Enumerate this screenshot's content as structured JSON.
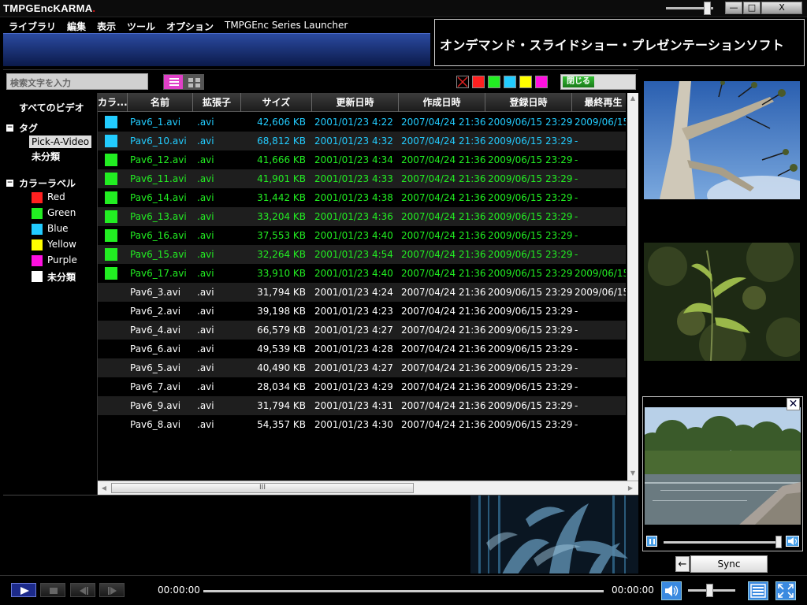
{
  "app": {
    "title_prefix": "TMPGEnc",
    "title_main": "KARMA",
    "title_dot": ".",
    "window_buttons": {
      "minimize": "—",
      "maximize": "□",
      "close": "X"
    }
  },
  "menu": [
    "ライブラリ",
    "編集",
    "表示",
    "ツール",
    "オプション",
    "TMPGEnc Series Launcher"
  ],
  "banner": "オンデマンド・スライドショー・プレゼンテーションソフト",
  "toolbar": {
    "search_placeholder": "検索文字を入力",
    "filter_colors": [
      "#ff2020",
      "#22ee22",
      "#22ccff",
      "#ffff00",
      "#ff10e0"
    ],
    "close_label": "閉じる"
  },
  "tree": {
    "all_videos": "すべてのビデオ",
    "tag_header": "タグ",
    "tag_expander": "−",
    "tags": [
      "Pick-A-Video",
      "未分類"
    ],
    "color_header": "カラーラベル",
    "color_expander": "−",
    "color_labels": [
      {
        "name": "Red",
        "color": "#ff2020"
      },
      {
        "name": "Green",
        "color": "#22ee22"
      },
      {
        "name": "Blue",
        "color": "#22ccff"
      },
      {
        "name": "Yellow",
        "color": "#ffff00"
      },
      {
        "name": "Purple",
        "color": "#ff10e0"
      },
      {
        "name": "未分類",
        "color": "#ffffff"
      }
    ]
  },
  "table": {
    "columns": [
      "カラ...",
      "名前",
      "拡張子",
      "サイズ",
      "更新日時",
      "作成日時",
      "登録日時",
      "最終再生"
    ],
    "rows": [
      {
        "color": "#22ccff",
        "text_color": "#22ccff",
        "name": "Pav6_1.avi",
        "ext": ".avi",
        "size": "42,606 KB",
        "modified": "2001/01/23 4:22",
        "created": "2007/04/24 21:36",
        "registered": "2009/06/15 23:29",
        "last_played": "2009/06/15"
      },
      {
        "color": "#22ccff",
        "text_color": "#22ccff",
        "name": "Pav6_10.avi",
        "ext": ".avi",
        "size": "68,812 KB",
        "modified": "2001/01/23 4:32",
        "created": "2007/04/24 21:36",
        "registered": "2009/06/15 23:29",
        "last_played": "-"
      },
      {
        "color": "#22ee22",
        "text_color": "#22ee22",
        "name": "Pav6_12.avi",
        "ext": ".avi",
        "size": "41,666 KB",
        "modified": "2001/01/23 4:34",
        "created": "2007/04/24 21:36",
        "registered": "2009/06/15 23:29",
        "last_played": "-"
      },
      {
        "color": "#22ee22",
        "text_color": "#22ee22",
        "name": "Pav6_11.avi",
        "ext": ".avi",
        "size": "41,901 KB",
        "modified": "2001/01/23 4:33",
        "created": "2007/04/24 21:36",
        "registered": "2009/06/15 23:29",
        "last_played": "-"
      },
      {
        "color": "#22ee22",
        "text_color": "#22ee22",
        "name": "Pav6_14.avi",
        "ext": ".avi",
        "size": "31,442 KB",
        "modified": "2001/01/23 4:38",
        "created": "2007/04/24 21:36",
        "registered": "2009/06/15 23:29",
        "last_played": "-"
      },
      {
        "color": "#22ee22",
        "text_color": "#22ee22",
        "name": "Pav6_13.avi",
        "ext": ".avi",
        "size": "33,204 KB",
        "modified": "2001/01/23 4:36",
        "created": "2007/04/24 21:36",
        "registered": "2009/06/15 23:29",
        "last_played": "-"
      },
      {
        "color": "#22ee22",
        "text_color": "#22ee22",
        "name": "Pav6_16.avi",
        "ext": ".avi",
        "size": "37,553 KB",
        "modified": "2001/01/23 4:40",
        "created": "2007/04/24 21:36",
        "registered": "2009/06/15 23:29",
        "last_played": "-"
      },
      {
        "color": "#22ee22",
        "text_color": "#22ee22",
        "name": "Pav6_15.avi",
        "ext": ".avi",
        "size": "32,264 KB",
        "modified": "2001/01/23 4:54",
        "created": "2007/04/24 21:36",
        "registered": "2009/06/15 23:29",
        "last_played": "-"
      },
      {
        "color": "#22ee22",
        "text_color": "#22ee22",
        "name": "Pav6_17.avi",
        "ext": ".avi",
        "size": "33,910 KB",
        "modified": "2001/01/23 4:40",
        "created": "2007/04/24 21:36",
        "registered": "2009/06/15 23:29",
        "last_played": "2009/06/15"
      },
      {
        "color": "",
        "text_color": "#ffffff",
        "name": "Pav6_3.avi",
        "ext": ".avi",
        "size": "31,794 KB",
        "modified": "2001/01/23 4:24",
        "created": "2007/04/24 21:36",
        "registered": "2009/06/15 23:29",
        "last_played": "2009/06/15"
      },
      {
        "color": "",
        "text_color": "#ffffff",
        "name": "Pav6_2.avi",
        "ext": ".avi",
        "size": "39,198 KB",
        "modified": "2001/01/23 4:23",
        "created": "2007/04/24 21:36",
        "registered": "2009/06/15 23:29",
        "last_played": "-"
      },
      {
        "color": "",
        "text_color": "#ffffff",
        "name": "Pav6_4.avi",
        "ext": ".avi",
        "size": "66,579 KB",
        "modified": "2001/01/23 4:27",
        "created": "2007/04/24 21:36",
        "registered": "2009/06/15 23:29",
        "last_played": "-"
      },
      {
        "color": "",
        "text_color": "#ffffff",
        "name": "Pav6_6.avi",
        "ext": ".avi",
        "size": "49,539 KB",
        "modified": "2001/01/23 4:28",
        "created": "2007/04/24 21:36",
        "registered": "2009/06/15 23:29",
        "last_played": "-"
      },
      {
        "color": "",
        "text_color": "#ffffff",
        "name": "Pav6_5.avi",
        "ext": ".avi",
        "size": "40,490 KB",
        "modified": "2001/01/23 4:27",
        "created": "2007/04/24 21:36",
        "registered": "2009/06/15 23:29",
        "last_played": "-"
      },
      {
        "color": "",
        "text_color": "#ffffff",
        "name": "Pav6_7.avi",
        "ext": ".avi",
        "size": "28,034 KB",
        "modified": "2001/01/23 4:29",
        "created": "2007/04/24 21:36",
        "registered": "2009/06/15 23:29",
        "last_played": "-"
      },
      {
        "color": "",
        "text_color": "#ffffff",
        "name": "Pav6_9.avi",
        "ext": ".avi",
        "size": "31,794 KB",
        "modified": "2001/01/23 4:31",
        "created": "2007/04/24 21:36",
        "registered": "2009/06/15 23:29",
        "last_played": "-"
      },
      {
        "color": "",
        "text_color": "#ffffff",
        "name": "Pav6_8.avi",
        "ext": ".avi",
        "size": "54,357 KB",
        "modified": "2001/01/23 4:30",
        "created": "2007/04/24 21:36",
        "registered": "2009/06/15 23:29",
        "last_played": "-"
      }
    ],
    "scroll_up": "▲",
    "scroll_down": "▼",
    "scroll_left": "◀",
    "scroll_right": "▶",
    "hscroll_grip": "III"
  },
  "preview": {
    "close_label": "✕",
    "sync_back": "←",
    "sync_label": "Sync",
    "seek_fraction": 0.97
  },
  "playback": {
    "time_current": "00:00:00",
    "time_total": "00:00:00",
    "volume_fraction": 0.45
  },
  "thumbnails": [
    "tree-branch-sky",
    "plant-leaves",
    "river-trees"
  ],
  "icons": {
    "play": "play-icon",
    "stop": "stop-icon",
    "prev": "prev-frame-icon",
    "next": "next-frame-icon",
    "volume": "speaker-icon",
    "list": "list-view-icon",
    "fullscreen": "fullscreen-icon"
  }
}
